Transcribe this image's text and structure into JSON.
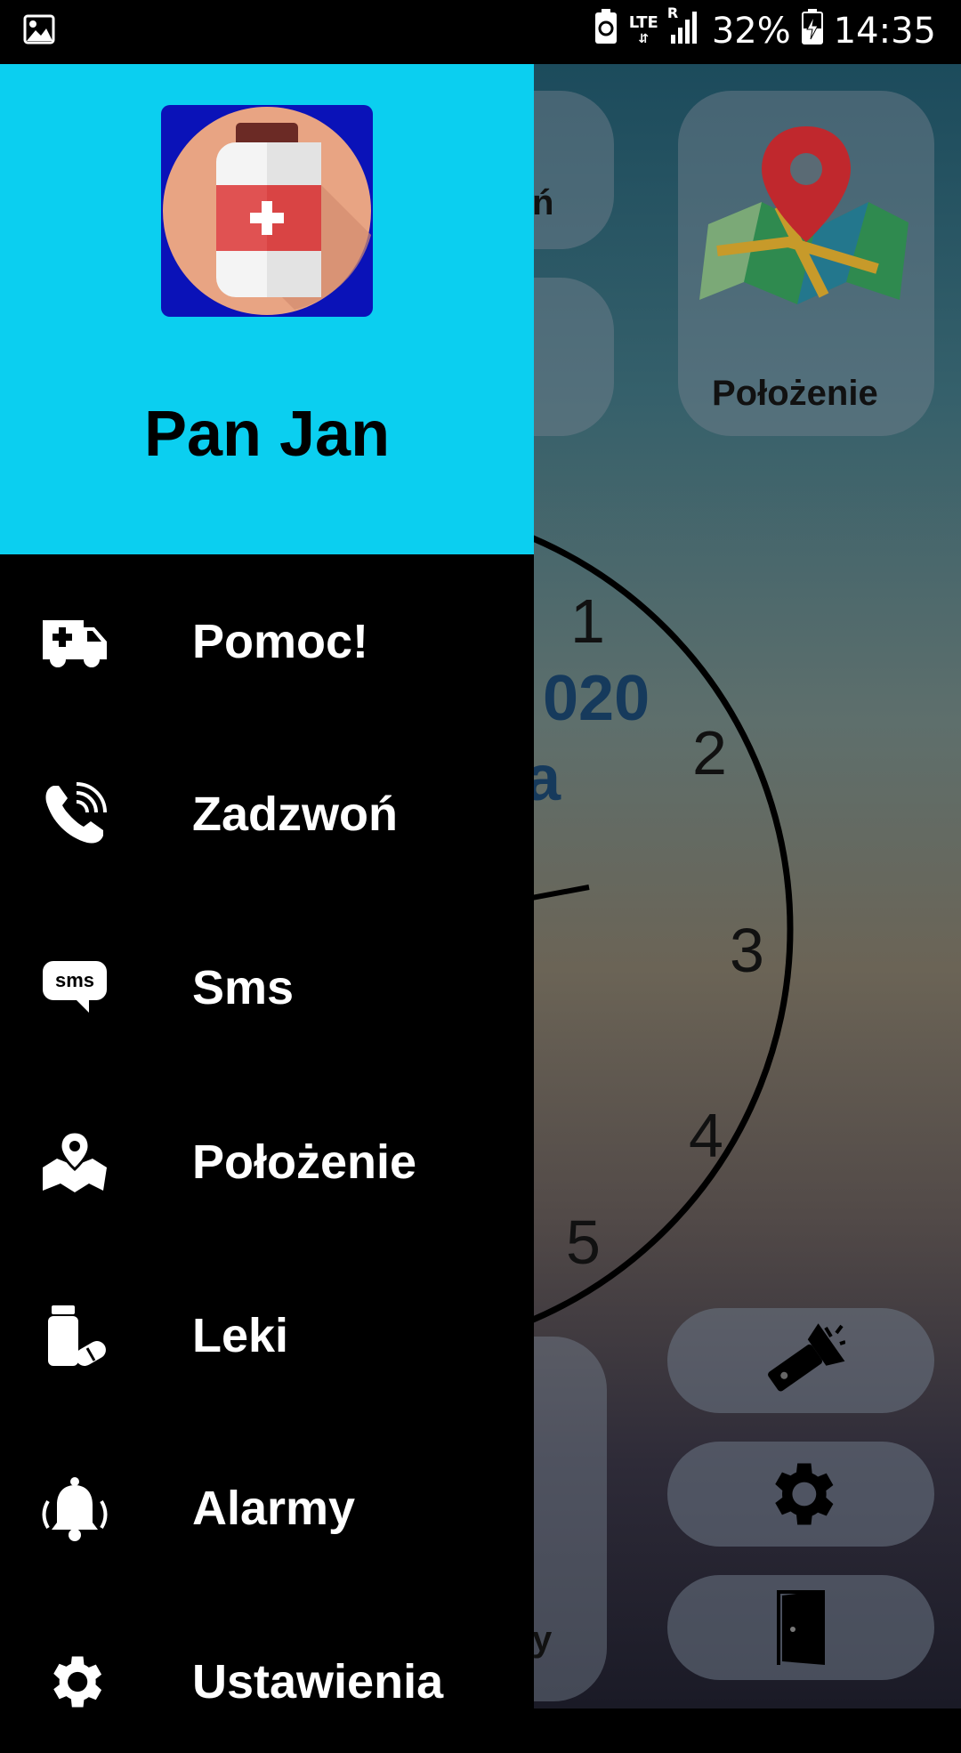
{
  "status_bar": {
    "network": "LTE",
    "roaming": "R",
    "battery": "32%",
    "time": "14:35",
    "icons": [
      "image-icon",
      "battery-saver-icon",
      "signal-icon",
      "battery-charging-icon"
    ]
  },
  "drawer": {
    "header_color": "#0bcff0",
    "user_name": "Pan Jan",
    "items": [
      {
        "label": "Pomoc!",
        "icon": "ambulance-icon"
      },
      {
        "label": "Zadzwoń",
        "icon": "phone-icon"
      },
      {
        "label": "Sms",
        "icon": "sms-icon"
      },
      {
        "label": "Położenie",
        "icon": "map-pin-icon"
      },
      {
        "label": "Leki",
        "icon": "pills-icon"
      },
      {
        "label": "Alarmy",
        "icon": "bell-icon"
      },
      {
        "label": "Ustawienia",
        "icon": "gear-icon"
      }
    ]
  },
  "background": {
    "tile_call_label": "ń",
    "tile_location_label": "Położenie",
    "tile_alarms_label": "y",
    "date_line1": "020",
    "date_line2": "a",
    "clock_numbers": [
      "1",
      "2",
      "3",
      "4",
      "5",
      "5"
    ]
  }
}
